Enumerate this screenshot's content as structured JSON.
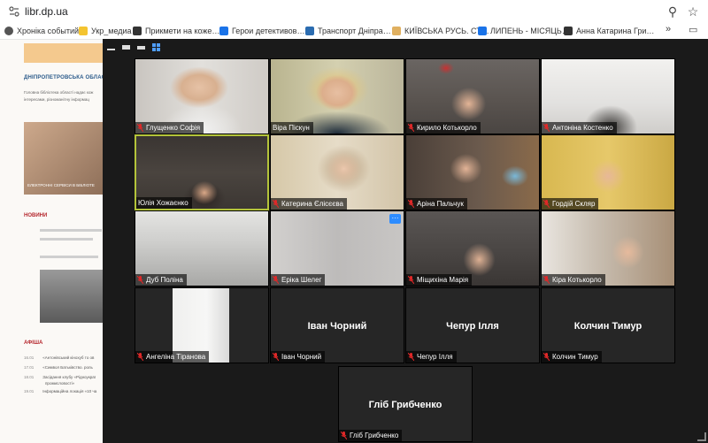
{
  "browser": {
    "url": "libr.dp.ua",
    "bookmarks": [
      {
        "label": "Хроніка событий",
        "color": "#555555"
      },
      {
        "label": "Укр_медиа",
        "color": "#f4c430"
      },
      {
        "label": "Прикмети на коже…",
        "color": "#333333"
      },
      {
        "label": "Герои детективов…",
        "color": "#1a73e8"
      },
      {
        "label": "Транспорт Дніпра…",
        "color": "#2b6cb0"
      },
      {
        "label": "КИЇВСЬКА РУСЬ. СТ…",
        "color": "#e0b060"
      },
      {
        "label": "ЛИПЕНЬ - МІСЯЦЬ…",
        "color": "#1a73e8"
      },
      {
        "label": "Анна Катарина Гри…",
        "color": "#333333"
      }
    ],
    "more": "»"
  },
  "library_page": {
    "title": "ДНІПРОПЕТРОВСЬКА ОБЛАСНА",
    "intro_lines": [
      "Головна бібліотека області надає кож",
      "інтересами, різноманітну інформац"
    ],
    "services_caption": "ЕЛЕКТРОННІ СЕРВІСИ В БІБЛІОТЕ",
    "news_heading": "НОВИНИ",
    "afisha_heading": "АФІША",
    "events": [
      {
        "date": "16.01",
        "text": "«Антонівський кінохуб то ов"
      },
      {
        "date": "17.01",
        "text": "«Символ Батьківство. роль"
      },
      {
        "date": "18.01",
        "text": "Засідання клубу «Рідноукраї"
      },
      {
        "date": "",
        "text": "промисловості»"
      },
      {
        "date": "19.01",
        "text": "Інформаційна локація «10 ча"
      }
    ]
  },
  "zoom": {
    "participants": [
      {
        "name": "Глущенко Софія"
      },
      {
        "name": "Віра Піскун"
      },
      {
        "name": "Кирило Котькорло"
      },
      {
        "name": "Антоніна Костенко"
      },
      {
        "name": "Юлія Хожаєнко"
      },
      {
        "name": "Катерина Єлісєєва"
      },
      {
        "name": "Аріна Пальчук"
      },
      {
        "name": "Гордій Скляр"
      },
      {
        "name": "Дуб Поліна"
      },
      {
        "name": "Еріка Шелег"
      },
      {
        "name": "Міщихіна Марія"
      },
      {
        "name": "Кіра Котькорло"
      },
      {
        "name": "Ангеліна Тіранова"
      },
      {
        "name": "Іван Чорний"
      },
      {
        "name": "Чепур Ілля"
      },
      {
        "name": "Колчин Тимур"
      },
      {
        "name": "Гліб Грибченко"
      }
    ]
  }
}
